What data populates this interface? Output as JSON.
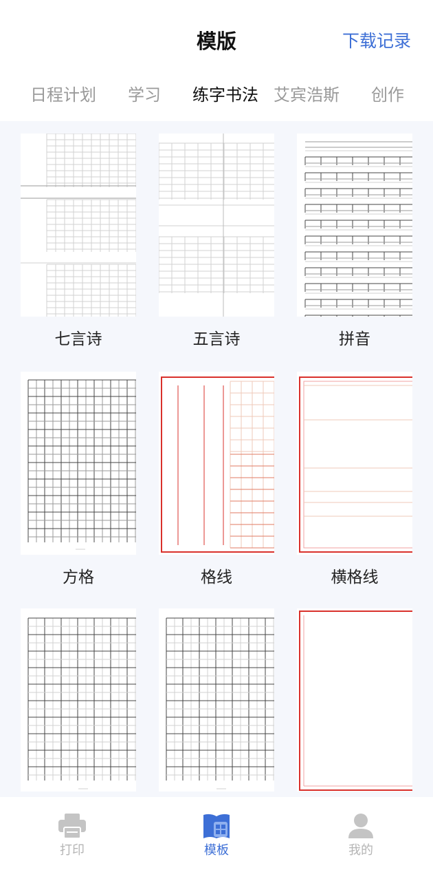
{
  "header": {
    "title": "模版",
    "download_label": "下载记录"
  },
  "tabs": [
    {
      "label": "日程计划",
      "active": false
    },
    {
      "label": "学习",
      "active": false
    },
    {
      "label": "练字书法",
      "active": true
    },
    {
      "label": "艾宾浩斯",
      "active": false
    },
    {
      "label": "创作",
      "active": false
    }
  ],
  "templates": [
    {
      "label": "七言诗"
    },
    {
      "label": "五言诗"
    },
    {
      "label": "拼音"
    },
    {
      "label": "方格"
    },
    {
      "label": "格线"
    },
    {
      "label": "横格线"
    },
    {
      "label": ""
    },
    {
      "label": ""
    },
    {
      "label": ""
    }
  ],
  "tabbar": [
    {
      "label": "打印",
      "icon": "printer-icon",
      "active": false
    },
    {
      "label": "模板",
      "icon": "template-book-icon",
      "active": true
    },
    {
      "label": "我的",
      "icon": "user-icon",
      "active": false
    }
  ],
  "colors": {
    "accent": "#3d6fd6",
    "inactive": "#b5b5b5",
    "frame_red": "#d9302b"
  }
}
